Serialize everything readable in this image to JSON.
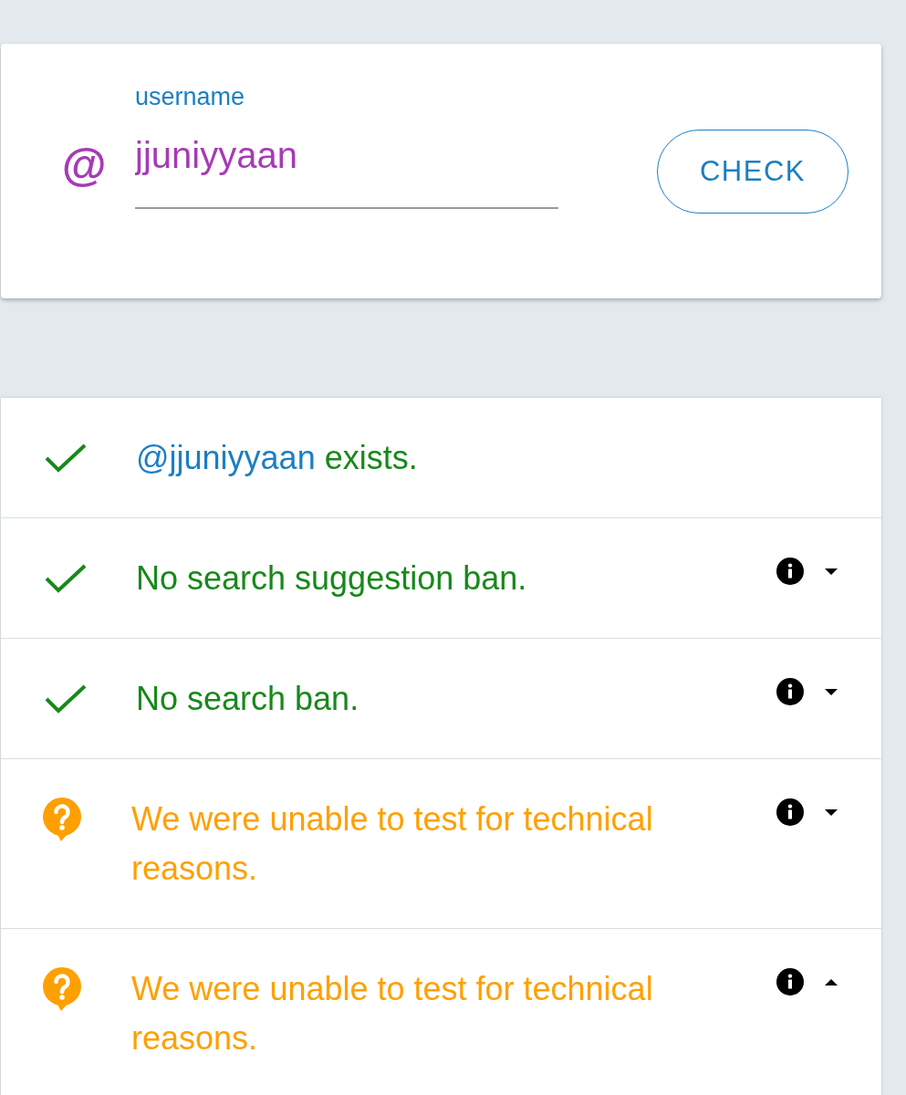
{
  "search": {
    "prefix": "@",
    "label": "username",
    "value": "jjuniyyaan",
    "button": "CHECK"
  },
  "results": [
    {
      "kind": "pass",
      "handle": "@jjuniyyaan",
      "text": "exists."
    },
    {
      "kind": "pass",
      "text": "No search suggestion ban.",
      "expanded": false
    },
    {
      "kind": "pass",
      "text": "No search ban.",
      "expanded": false
    },
    {
      "kind": "unknown",
      "text": "We were unable to test for technical reasons.",
      "expanded": false
    },
    {
      "kind": "unknown",
      "text": "We were unable to test for technical reasons.",
      "expanded": true
    }
  ]
}
